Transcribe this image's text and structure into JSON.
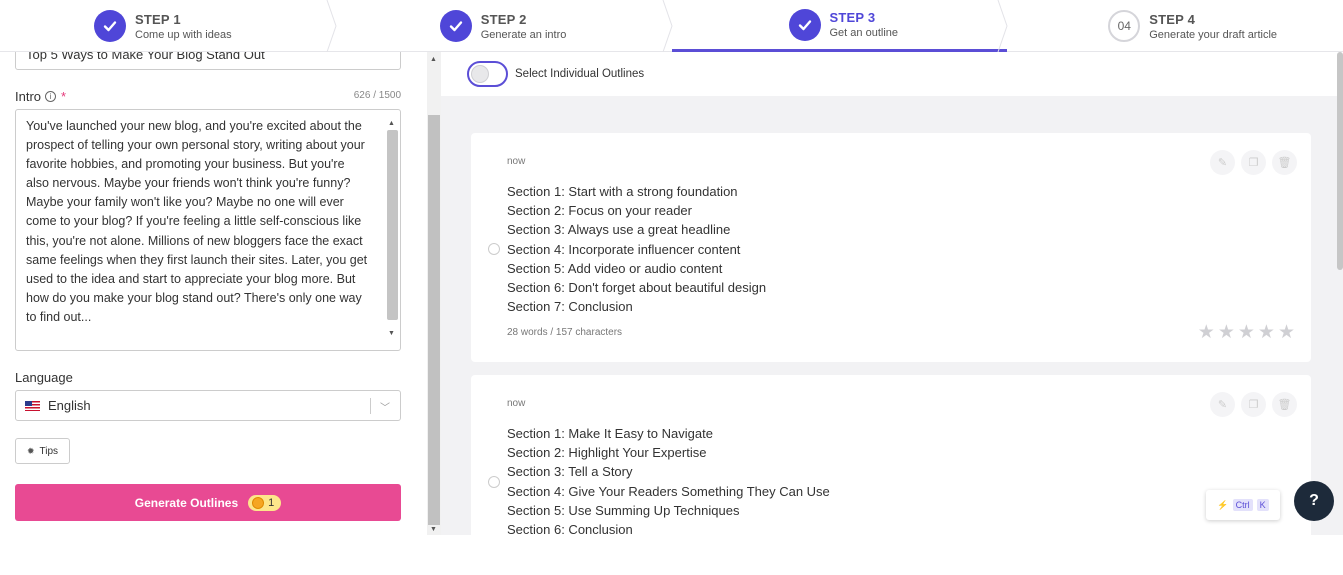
{
  "steps": [
    {
      "title": "STEP 1",
      "subtitle": "Come up with ideas",
      "state": "done"
    },
    {
      "title": "STEP 2",
      "subtitle": "Generate an intro",
      "state": "done"
    },
    {
      "title": "STEP 3",
      "subtitle": "Get an outline",
      "state": "active"
    },
    {
      "title": "STEP 4",
      "subtitle": "Generate your draft article",
      "state": "pending",
      "number": "04"
    }
  ],
  "form": {
    "title_value": "Top 5 Ways to Make Your Blog Stand Out",
    "intro_label": "Intro",
    "intro_required": "*",
    "intro_count": "626 / 1500",
    "intro_value": "You've launched your new blog, and you're excited about the prospect of telling your own personal story, writing about your favorite hobbies, and promoting your business. But you're also nervous. Maybe your friends won't think you're funny? Maybe your family won't like you? Maybe no one will ever come to your blog? If you're feeling a little self-conscious like this, you're not alone. Millions of new bloggers face the exact same feelings when they first launch their sites. Later, you get used to the idea and start to appreciate your blog more. But how do you make your blog stand out? There's only one way to find out...",
    "language_label": "Language",
    "language_value": "English",
    "tips_label": "Tips",
    "generate_label": "Generate Outlines",
    "credit_cost": "1"
  },
  "outlines": {
    "toggle_label": "Select Individual Outlines",
    "cards": [
      {
        "time": "now",
        "sections": [
          "Section 1:  Start with a strong foundation",
          "Section 2:  Focus on your reader",
          "Section 3:  Always use a great headline",
          "Section 4:  Incorporate influencer content",
          "Section 5:  Add video or audio content",
          "Section 6:  Don't forget about beautiful design",
          "Section 7:  Conclusion"
        ],
        "meta": "28 words / 157 characters"
      },
      {
        "time": "now",
        "sections": [
          "Section 1:  Make It Easy to Navigate",
          "Section 2:  Highlight Your Expertise",
          "Section 3:  Tell a Story",
          "Section 4:  Give Your Readers Something They Can Use",
          "Section 5:  Use Summing Up Techniques",
          "Section 6:  Conclusion"
        ]
      }
    ]
  },
  "shortcut": {
    "key1": "Ctrl",
    "key2": "K"
  },
  "help": {
    "label": "?"
  },
  "colors": {
    "accent": "#4f46d8",
    "pink": "#e84a93",
    "dark": "#1d2a3a"
  }
}
